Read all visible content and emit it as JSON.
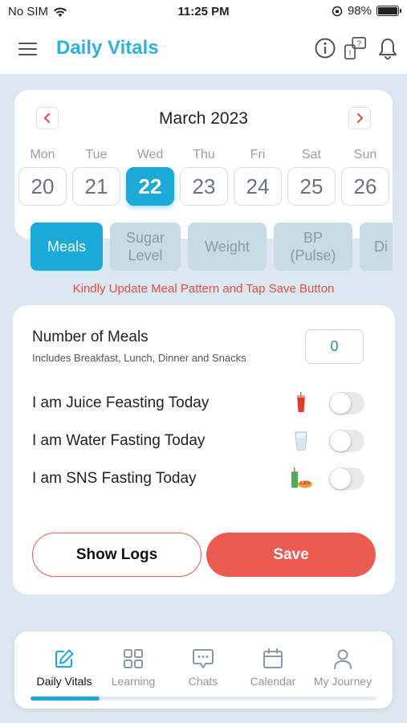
{
  "status_bar": {
    "carrier": "No SIM",
    "time": "11:25 PM",
    "battery": "98%",
    "battery_level": 0.98
  },
  "app_bar": {
    "title": "Daily Vitals",
    "icons": [
      "menu-icon",
      "info-icon",
      "help-icon",
      "bell-icon"
    ]
  },
  "calendar": {
    "month": "March 2023",
    "prev_icon": "chevron-left-icon",
    "next_icon": "chevron-right-icon",
    "days": [
      {
        "name": "Mon",
        "num": "20",
        "selected": false
      },
      {
        "name": "Tue",
        "num": "21",
        "selected": false
      },
      {
        "name": "Wed",
        "num": "22",
        "selected": true
      },
      {
        "name": "Thu",
        "num": "23",
        "selected": false
      },
      {
        "name": "Fri",
        "num": "24",
        "selected": false
      },
      {
        "name": "Sat",
        "num": "25",
        "selected": false
      },
      {
        "name": "Sun",
        "num": "26",
        "selected": false
      }
    ]
  },
  "tabs": [
    {
      "label": "Meals",
      "active": true
    },
    {
      "label": "Sugar\nLevel",
      "active": false
    },
    {
      "label": "Weight",
      "active": false
    },
    {
      "label": "BP\n(Pulse)",
      "active": false
    },
    {
      "label": "Di",
      "active": false
    }
  ],
  "notice": "Kindly Update Meal Pattern and Tap Save Button",
  "form": {
    "meals_label": "Number of Meals",
    "meals_sub": "Includes Breakfast, Lunch, Dinner and Snacks",
    "meals_value": "0",
    "fasting": [
      {
        "label": "I am Juice Feasting Today",
        "icon": "juice-icon",
        "on": false
      },
      {
        "label": "I am Water Fasting Today",
        "icon": "water-glass-icon",
        "on": false
      },
      {
        "label": "I am SNS Fasting Today",
        "icon": "sns-food-icon",
        "on": false
      }
    ],
    "show_logs": "Show Logs",
    "save": "Save"
  },
  "colors": {
    "accent": "#1ba9d8",
    "title": "#2ab3dc",
    "alert": "#e24e43",
    "save": "#ec5b4f"
  },
  "bottom_nav": {
    "items": [
      {
        "label": "Daily Vitals",
        "icon": "edit-icon",
        "active": true
      },
      {
        "label": "Learning",
        "icon": "grid-icon",
        "active": false
      },
      {
        "label": "Chats",
        "icon": "chat-icon",
        "active": false
      },
      {
        "label": "Calendar",
        "icon": "calendar-icon",
        "active": false
      },
      {
        "label": "My Journey",
        "icon": "user-icon",
        "active": false
      }
    ]
  }
}
